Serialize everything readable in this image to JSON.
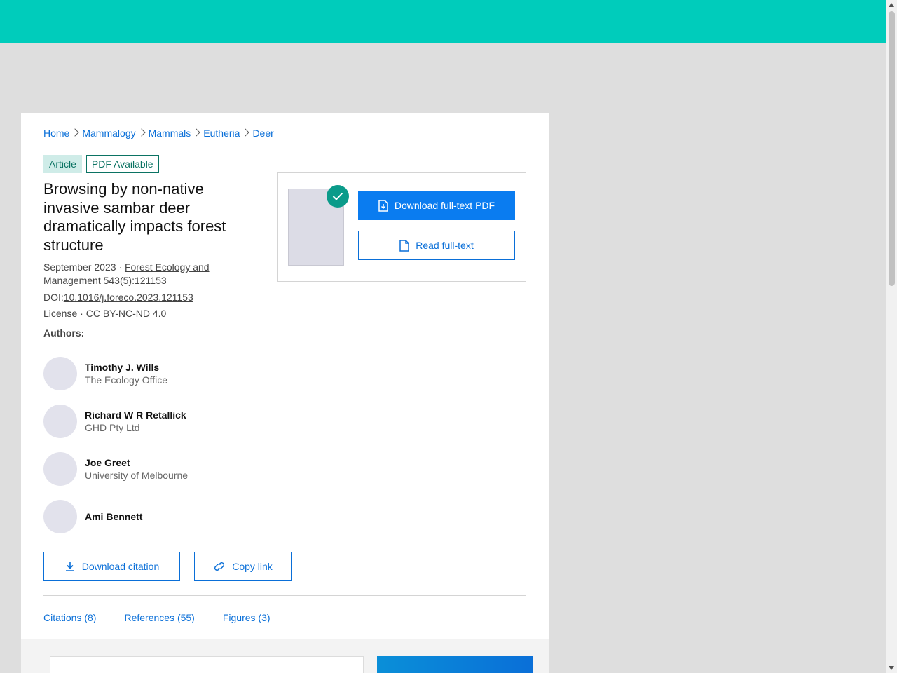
{
  "breadcrumb": [
    "Home",
    "Mammalogy",
    "Mammals",
    "Eutheria",
    "Deer"
  ],
  "badges": {
    "article": "Article",
    "pdf": "PDF Available"
  },
  "article": {
    "title": "Browsing by non-native invasive sambar deer dramatically impacts forest structure",
    "date": "September 2023 · ",
    "journal": "Forest Ecology and Management",
    "volume": " 543(5):121153",
    "doi_label": "DOI:",
    "doi": "10.1016/j.foreco.2023.121153",
    "license_label": "License · ",
    "license": "CC BY-NC-ND 4.0"
  },
  "authors_label": "Authors:",
  "authors": [
    {
      "name": "Timothy J. Wills",
      "affiliation": "The Ecology Office"
    },
    {
      "name": "Richard W R Retallick",
      "affiliation": "GHD Pty Ltd"
    },
    {
      "name": "Joe Greet",
      "affiliation": "University of Melbourne"
    },
    {
      "name": "Ami Bennett",
      "affiliation": ""
    }
  ],
  "actions": {
    "download_citation": "Download citation",
    "copy_link": "Copy link",
    "download_pdf": "Download full-text PDF",
    "read_fulltext": "Read full-text"
  },
  "tabs": [
    "Citations (8)",
    "References (55)",
    "Figures (3)"
  ],
  "colors": {
    "brand_teal": "#00ccbb",
    "link_blue": "#0a6fd8",
    "primary_button": "#0a7cf0",
    "badge_teal": "#0b7363"
  }
}
